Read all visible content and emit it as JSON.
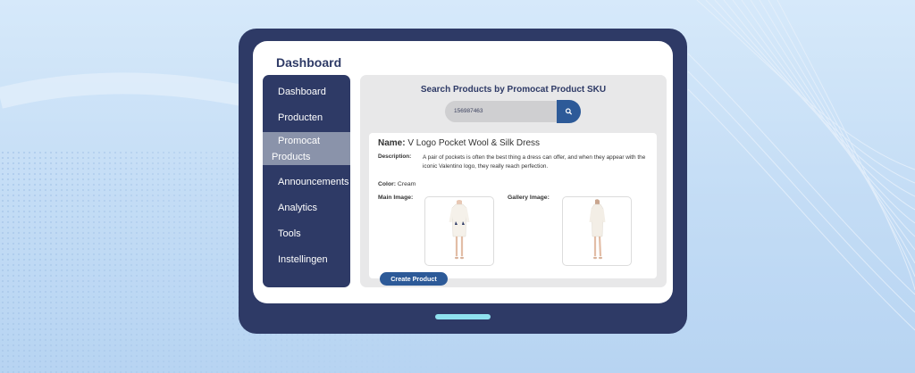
{
  "page": {
    "title": "Dashboard"
  },
  "sidebar": {
    "items": [
      {
        "label": "Dashboard"
      },
      {
        "label": "Producten"
      },
      {
        "label_line1": "Promocat",
        "label_line2": "Products",
        "active": true
      },
      {
        "label": "Announcements"
      },
      {
        "label": "Analytics"
      },
      {
        "label": "Tools"
      },
      {
        "label": "Instellingen"
      }
    ]
  },
  "search": {
    "title": "Search Products by Promocat Product SKU",
    "value": "156987463",
    "button_icon": "search-icon"
  },
  "product": {
    "name_label": "Name:",
    "name": "V Logo Pocket Wool & Silk Dress",
    "description_label": "Description:",
    "description": "A pair of pockets is often the best thing a dress can offer, and when they appear with the iconic Valentino logo, they really reach perfection.",
    "color_label": "Color:",
    "color": "Cream",
    "main_image_label": "Main Image:",
    "gallery_image_label": "Gallery Image:"
  },
  "actions": {
    "create_label": "Create Product"
  },
  "colors": {
    "frame": "#2e3a66",
    "accent": "#2d5a98",
    "active_nav": "#8a93aa",
    "panel": "#e8e8e9",
    "home_bar": "#8fe1ef"
  }
}
